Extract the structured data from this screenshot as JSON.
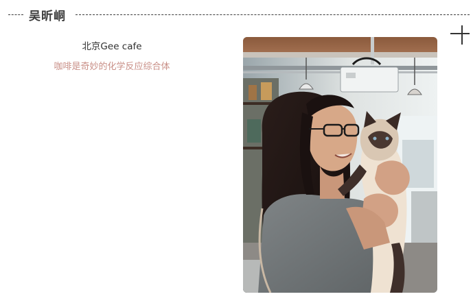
{
  "header": {
    "name": "吴昕峒"
  },
  "caption": {
    "place": "北京Gee cafe",
    "tagline": "咖啡是奇妙的化学反应综合体"
  },
  "colors": {
    "tagline": "#c98f87",
    "dashes": "#3a3a3a",
    "text": "#333333"
  },
  "icons": {
    "corner": "plus-icon"
  },
  "photo": {
    "subject": "woman-holding-siamese-cat-photo"
  }
}
